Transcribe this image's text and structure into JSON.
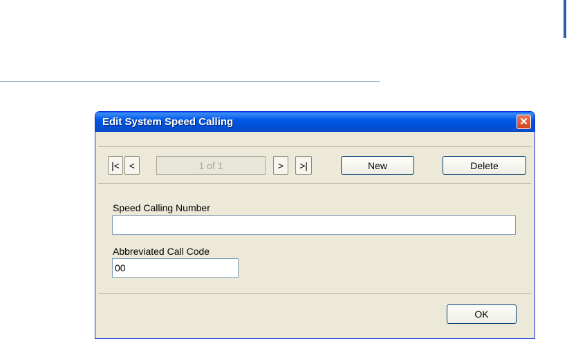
{
  "dialog": {
    "title": "Edit System Speed Calling",
    "close_symbol": "✕"
  },
  "navigation": {
    "first_label": "|<",
    "prev_label": "<",
    "record_indicator": "1 of 1",
    "next_label": ">",
    "last_label": ">|"
  },
  "actions": {
    "new_label": "New",
    "delete_label": "Delete",
    "ok_label": "OK"
  },
  "fields": {
    "speed_calling_number": {
      "label": "Speed Calling Number",
      "value": ""
    },
    "abbreviated_call_code": {
      "label": "Abbreviated Call Code",
      "value": "00"
    }
  },
  "colors": {
    "titlebar": "#0058e6",
    "dialog_background": "#ece9d8",
    "close_button": "#d2431a",
    "input_border": "#7f9db9"
  }
}
